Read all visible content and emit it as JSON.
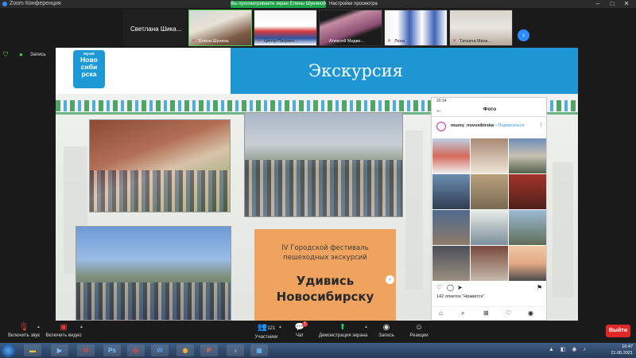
{
  "titlebar": {
    "app_title": "Zoom Конференция",
    "share_banner": "Вы просматриваете экран Елены Шуниной",
    "view_options": "Настройки просмотра"
  },
  "participants": [
    {
      "name": "Светлана  Шика...",
      "muted": true,
      "video": false
    },
    {
      "name": "Елена  Шунина",
      "muted": true,
      "video": true,
      "active": true
    },
    {
      "name": "Центр  Патриот...",
      "muted": true,
      "video": true
    },
    {
      "name": "Алексей Медве...",
      "muted": true,
      "video": true
    },
    {
      "name": "Лена",
      "muted": true,
      "video": true
    },
    {
      "name": "Татьяна  Миха...",
      "muted": true,
      "video": true
    }
  ],
  "meeting_info": {
    "label": "Запись"
  },
  "slide": {
    "logo_small": "Музей",
    "logo_big": [
      "Ново",
      "сиби",
      "рска"
    ],
    "title": "Экскурсия",
    "festival": {
      "line1": "IV Городской фестиваль",
      "line2": "пешеходных экскурсий",
      "line3": "Удивись",
      "line4": "Новосибирску"
    },
    "phone": {
      "status_time": "20:14",
      "header": "Фото",
      "username": "muzey_novosibirska",
      "follow": "• Подписаться",
      "likes": "142 отметок \"Нравится\""
    }
  },
  "toolbar": {
    "audio": "Включить звук",
    "video": "Включить видео",
    "participants": "Участники",
    "participants_count": "121",
    "chat": "Чат",
    "chat_badge": "1",
    "share": "Демонстрация экрана",
    "record": "Запись",
    "reactions": "Реакции",
    "end": "Выйти"
  },
  "taskbar": {
    "apps": [
      "W",
      "Ps",
      "W",
      "P"
    ],
    "time": "10:47",
    "date": "21.06.2021"
  },
  "colors": {
    "zoom_blue": "#2d8cff",
    "slide_blue": "#1e96d4",
    "festival_orange": "#f0a35e",
    "end_red": "#e02828",
    "share_green": "#1fa34a"
  }
}
